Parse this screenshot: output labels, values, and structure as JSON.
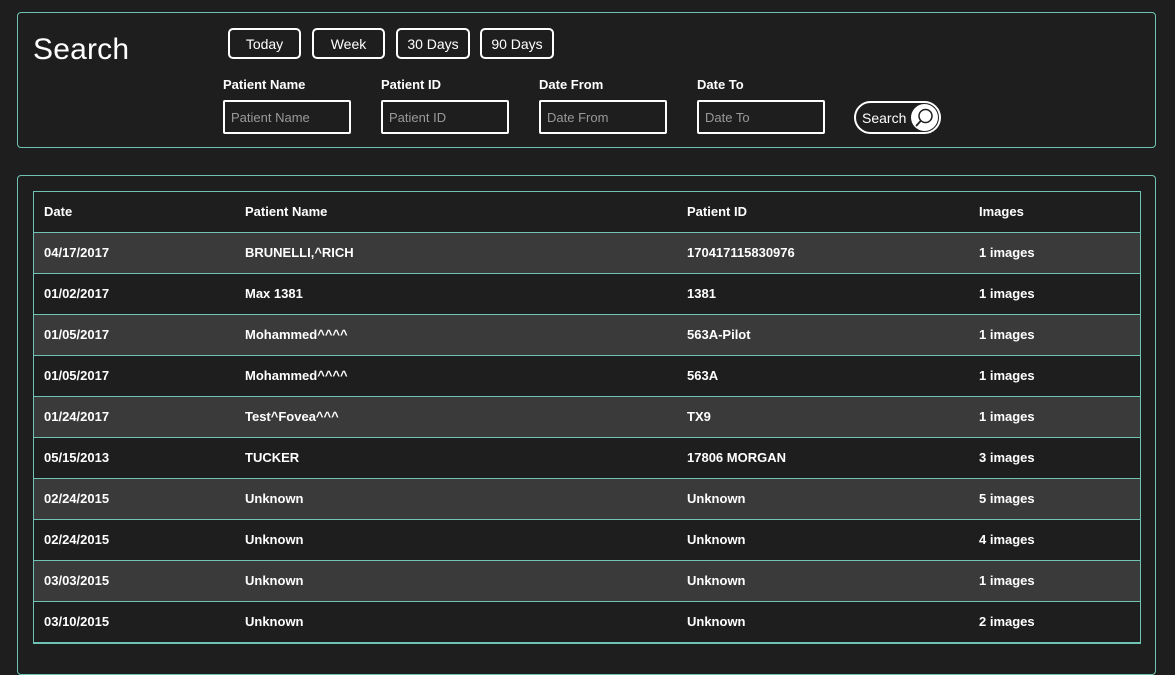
{
  "search": {
    "title": "Search",
    "quick_ranges": [
      "Today",
      "Week",
      "30 Days",
      "90 Days"
    ],
    "fields": [
      {
        "label": "Patient Name",
        "placeholder": "Patient Name",
        "value": ""
      },
      {
        "label": "Patient ID",
        "placeholder": "Patient ID",
        "value": ""
      },
      {
        "label": "Date From",
        "placeholder": "Date From",
        "value": ""
      },
      {
        "label": "Date To",
        "placeholder": "Date To",
        "value": ""
      }
    ],
    "button_label": "Search",
    "button_icon": "magnifier-icon"
  },
  "table": {
    "columns": [
      "Date",
      "Patient Name",
      "Patient ID",
      "Images"
    ],
    "rows": [
      [
        "04/17/2017",
        "BRUNELLI,^RICH",
        "170417115830976",
        "1 images"
      ],
      [
        "01/02/2017",
        "Max 1381",
        "1381",
        "1 images"
      ],
      [
        "01/05/2017",
        "Mohammed^^^^",
        "563A-Pilot",
        "1 images"
      ],
      [
        "01/05/2017",
        "Mohammed^^^^",
        "563A",
        "1 images"
      ],
      [
        "01/24/2017",
        "Test^Fovea^^^",
        "TX9",
        "1 images"
      ],
      [
        "05/15/2013",
        "TUCKER",
        "17806 MORGAN",
        "3 images"
      ],
      [
        "02/24/2015",
        "Unknown",
        "Unknown",
        "5 images"
      ],
      [
        "02/24/2015",
        "Unknown",
        "Unknown",
        "4 images"
      ],
      [
        "03/03/2015",
        "Unknown",
        "Unknown",
        "1 images"
      ],
      [
        "03/10/2015",
        "Unknown",
        "Unknown",
        "2 images"
      ]
    ]
  },
  "colors": {
    "background": "#1e1e1e",
    "accent_border": "#6fc3b2",
    "stripe": "#3a3a3a",
    "text": "#ffffff"
  }
}
